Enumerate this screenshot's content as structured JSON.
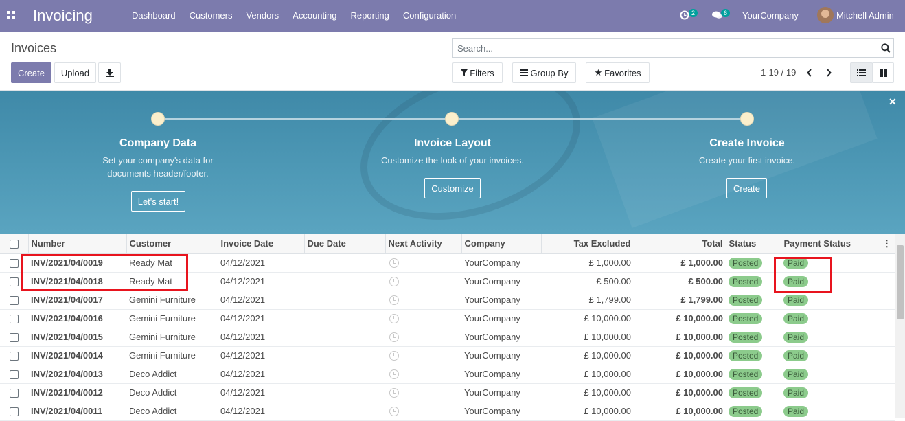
{
  "navbar": {
    "app_title": "Invoicing",
    "menu": [
      "Dashboard",
      "Customers",
      "Vendors",
      "Accounting",
      "Reporting",
      "Configuration"
    ],
    "activity_count": "2",
    "message_count": "6",
    "company": "YourCompany",
    "user": "Mitchell Admin"
  },
  "control": {
    "title": "Invoices",
    "create_label": "Create",
    "upload_label": "Upload",
    "search_placeholder": "Search...",
    "filters_label": "Filters",
    "groupby_label": "Group By",
    "favorites_label": "Favorites",
    "pager": "1-19 / 19"
  },
  "onboarding": {
    "steps": [
      {
        "title": "Company Data",
        "desc": "Set your company's data for documents header/footer.",
        "button": "Let's start!"
      },
      {
        "title": "Invoice Layout",
        "desc": "Customize the look of your invoices.",
        "button": "Customize"
      },
      {
        "title": "Create Invoice",
        "desc": "Create your first invoice.",
        "button": "Create"
      }
    ]
  },
  "table": {
    "headers": [
      "Number",
      "Customer",
      "Invoice Date",
      "Due Date",
      "Next Activity",
      "Company",
      "Tax Excluded",
      "Total",
      "Status",
      "Payment Status"
    ],
    "rows": [
      {
        "number": "INV/2021/04/0019",
        "customer": "Ready Mat",
        "date": "04/12/2021",
        "company": "YourCompany",
        "tax_excluded": "£ 1,000.00",
        "total": "£ 1,000.00",
        "status": "Posted",
        "payment": "Paid"
      },
      {
        "number": "INV/2021/04/0018",
        "customer": "Ready Mat",
        "date": "04/12/2021",
        "company": "YourCompany",
        "tax_excluded": "£ 500.00",
        "total": "£ 500.00",
        "status": "Posted",
        "payment": "Paid"
      },
      {
        "number": "INV/2021/04/0017",
        "customer": "Gemini Furniture",
        "date": "04/12/2021",
        "company": "YourCompany",
        "tax_excluded": "£ 1,799.00",
        "total": "£ 1,799.00",
        "status": "Posted",
        "payment": "Paid"
      },
      {
        "number": "INV/2021/04/0016",
        "customer": "Gemini Furniture",
        "date": "04/12/2021",
        "company": "YourCompany",
        "tax_excluded": "£ 10,000.00",
        "total": "£ 10,000.00",
        "status": "Posted",
        "payment": "Paid"
      },
      {
        "number": "INV/2021/04/0015",
        "customer": "Gemini Furniture",
        "date": "04/12/2021",
        "company": "YourCompany",
        "tax_excluded": "£ 10,000.00",
        "total": "£ 10,000.00",
        "status": "Posted",
        "payment": "Paid"
      },
      {
        "number": "INV/2021/04/0014",
        "customer": "Gemini Furniture",
        "date": "04/12/2021",
        "company": "YourCompany",
        "tax_excluded": "£ 10,000.00",
        "total": "£ 10,000.00",
        "status": "Posted",
        "payment": "Paid"
      },
      {
        "number": "INV/2021/04/0013",
        "customer": "Deco Addict",
        "date": "04/12/2021",
        "company": "YourCompany",
        "tax_excluded": "£ 10,000.00",
        "total": "£ 10,000.00",
        "status": "Posted",
        "payment": "Paid"
      },
      {
        "number": "INV/2021/04/0012",
        "customer": "Deco Addict",
        "date": "04/12/2021",
        "company": "YourCompany",
        "tax_excluded": "£ 10,000.00",
        "total": "£ 10,000.00",
        "status": "Posted",
        "payment": "Paid"
      },
      {
        "number": "INV/2021/04/0011",
        "customer": "Deco Addict",
        "date": "04/12/2021",
        "company": "YourCompany",
        "tax_excluded": "£ 10,000.00",
        "total": "£ 10,000.00",
        "status": "Posted",
        "payment": "Paid"
      }
    ]
  },
  "colors": {
    "brand": "#7c7bad",
    "highlight": "#e8141e",
    "paid": "#8ccb8c"
  }
}
